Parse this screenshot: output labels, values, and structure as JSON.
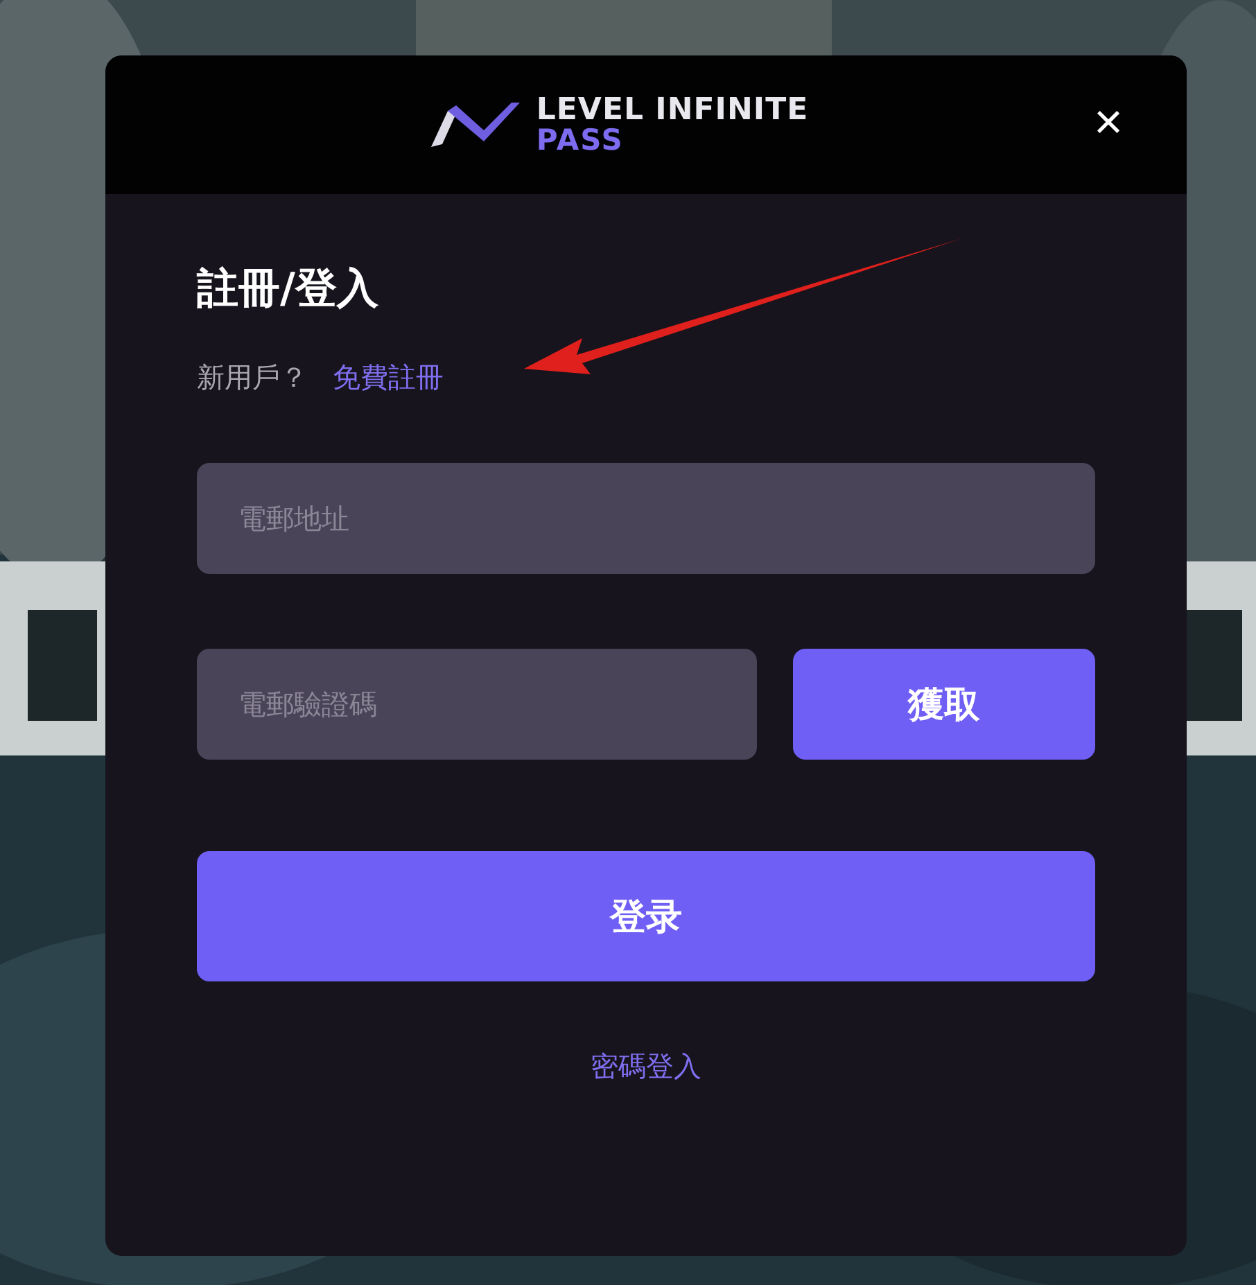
{
  "dialog": {
    "logo": {
      "line_1": "LEVEL INFINITE",
      "line_2": "PASS"
    },
    "close": "×",
    "title": "註冊/登入",
    "signup_prompt": "新用戶？",
    "signup_link": "免費註冊",
    "annotation": {
      "kind": "arrow",
      "color": "#e0201c"
    },
    "email_field": {
      "placeholder": "電郵地址"
    },
    "code_field": {
      "placeholder": "電郵驗證碼"
    },
    "get_code_button": "獲取",
    "login_button": "登录",
    "password_login_link": "密碼登入"
  }
}
